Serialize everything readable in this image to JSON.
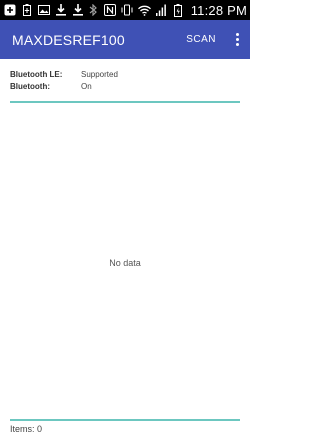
{
  "status_bar": {
    "left_icons": [
      "add-icon",
      "battery-saver-icon",
      "image-icon",
      "download-icon",
      "download-icon-2"
    ],
    "right_icons": [
      "bluetooth-icon",
      "nfc-icon",
      "vibrate-icon",
      "wifi-icon",
      "signal-icon",
      "battery-icon"
    ],
    "time": "11:28 PM"
  },
  "app_bar": {
    "title": "MAXDESREF100",
    "scan_label": "SCAN",
    "background": "#3f51b5"
  },
  "info": {
    "ble_label": "Bluetooth LE:",
    "ble_value": "Supported",
    "bt_label": "Bluetooth:",
    "bt_value": "On"
  },
  "list": {
    "empty_text": "No data",
    "divider_color": "#6cc7c0"
  },
  "footer": {
    "items_count": "Items: 0"
  }
}
